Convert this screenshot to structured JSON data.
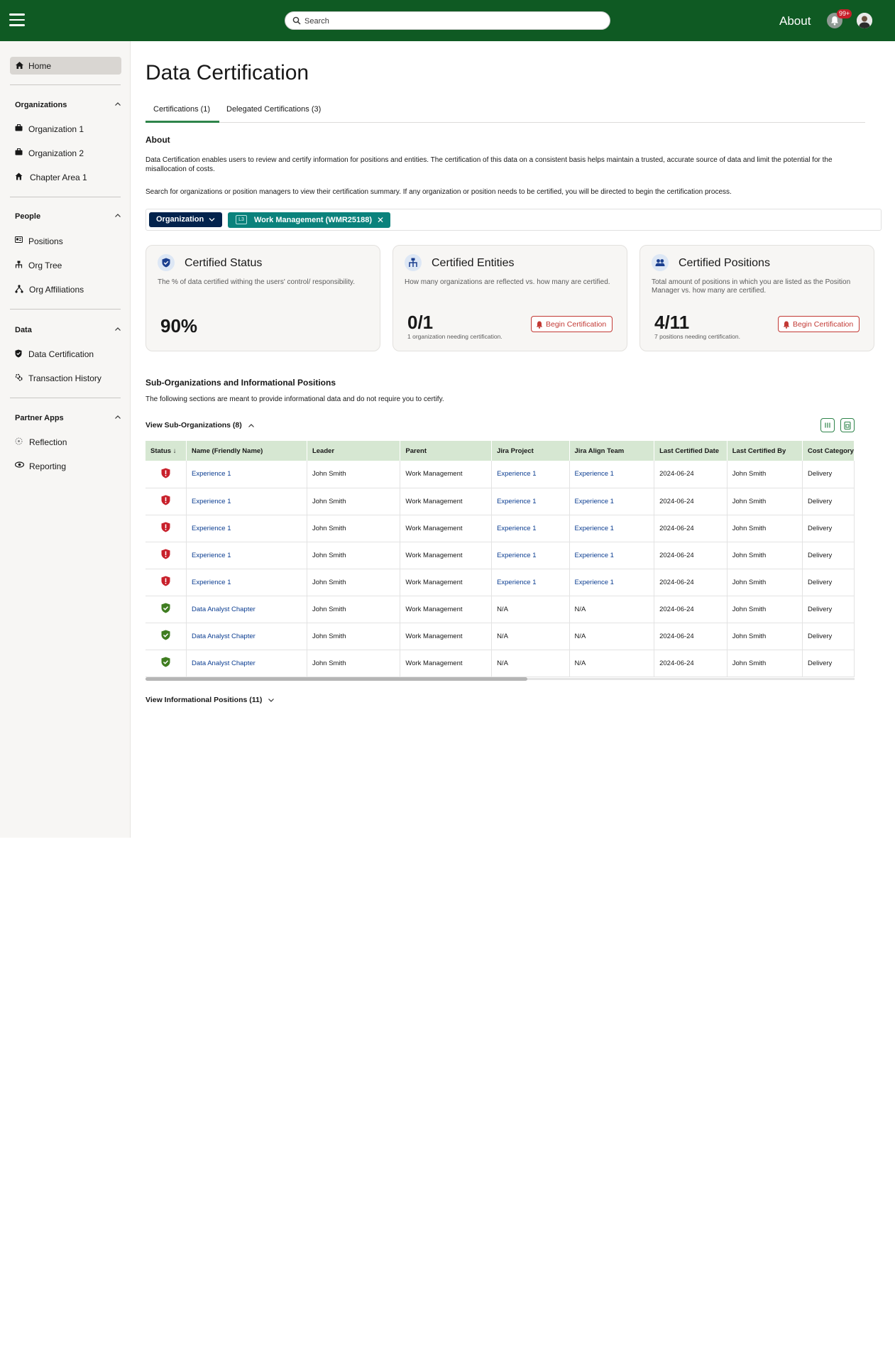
{
  "topbar": {
    "search_placeholder": "Search",
    "about": "About",
    "notification_badge": "99+",
    "bar_color": "#0f5a23"
  },
  "sidebar": {
    "home": "Home",
    "sections": [
      {
        "title": "Organizations",
        "items": [
          "Organization 1",
          "Organization 2",
          "Chapter Area 1"
        ]
      },
      {
        "title": "People",
        "items": [
          "Positions",
          "Org Tree",
          "Org Affiliations"
        ]
      },
      {
        "title": "Data",
        "items": [
          "Data Certification",
          "Transaction History"
        ]
      },
      {
        "title": "Partner Apps",
        "items": [
          "Reflection",
          "Reporting"
        ]
      }
    ]
  },
  "page": {
    "title": "Data Certification",
    "tabs": [
      "Certifications (1)",
      "Delegated Certifications (3)"
    ],
    "about_heading": "About",
    "about_text": "Data Certification enables users to review and certify information for positions and entities. The certification of this data on a consistent basis helps maintain a trusted, accurate source of data and limit the potential for the misallocation of costs.",
    "search_text": "Search for organizations or position managers to view their certification summary. If any organization or position needs to be certified, you will be directed to begin the certification process.",
    "filter": {
      "type_label": "Organization",
      "level": "L3",
      "selected": "Work Management (WMR25188)"
    }
  },
  "cards": [
    {
      "title": "Certified Status",
      "description": "The % of data certified withing the users' control/ responsibility.",
      "value": "90%",
      "note": "",
      "button": ""
    },
    {
      "title": "Certified Entities",
      "description": "How many organizations are reflected vs. how many are certified.",
      "value": "0/1",
      "note": "1 organization needing certification.",
      "button": "Begin Certification"
    },
    {
      "title": "Certified Positions",
      "description": "Total amount of positions in which you are listed as the Position Manager vs. how many are certified.",
      "value": "4/11",
      "note": "7 positions needing certification.",
      "button": "Begin Certification"
    }
  ],
  "sub_section": {
    "heading": "Sub-Organizations and Informational Positions",
    "description": "The following sections are meant to provide informational data and do not require you to certify.",
    "view_sub": "View Sub-Organizations (8)",
    "view_info": "View Informational Positions (11)"
  },
  "table": {
    "columns": [
      "Status",
      "Name (Friendly Name)",
      "Leader",
      "Parent",
      "Jira Project",
      "Jira Align Team",
      "Last Certified Date",
      "Last Certified By",
      "Cost Category"
    ],
    "rows": [
      {
        "status": "uncertified",
        "name": "Experience 1",
        "leader": "John Smith",
        "parent": "Work Management",
        "jira_project": "Experience 1",
        "jira_align": "Experience 1",
        "date": "2024-06-24",
        "by": "John Smith",
        "cost": "Delivery"
      },
      {
        "status": "uncertified",
        "name": "Experience 1",
        "leader": "John Smith",
        "parent": "Work Management",
        "jira_project": "Experience 1",
        "jira_align": "Experience 1",
        "date": "2024-06-24",
        "by": "John Smith",
        "cost": "Delivery"
      },
      {
        "status": "uncertified",
        "name": "Experience 1",
        "leader": "John Smith",
        "parent": "Work Management",
        "jira_project": "Experience 1",
        "jira_align": "Experience 1",
        "date": "2024-06-24",
        "by": "John Smith",
        "cost": "Delivery"
      },
      {
        "status": "uncertified",
        "name": "Experience 1",
        "leader": "John Smith",
        "parent": "Work Management",
        "jira_project": "Experience 1",
        "jira_align": "Experience 1",
        "date": "2024-06-24",
        "by": "John Smith",
        "cost": "Delivery"
      },
      {
        "status": "uncertified",
        "name": "Experience 1",
        "leader": "John Smith",
        "parent": "Work Management",
        "jira_project": "Experience 1",
        "jira_align": "Experience 1",
        "date": "2024-06-24",
        "by": "John Smith",
        "cost": "Delivery"
      },
      {
        "status": "certified",
        "name": "Data Analyst Chapter",
        "leader": "John Smith",
        "parent": "Work Management",
        "jira_project": "N/A",
        "jira_align": "N/A",
        "date": "2024-06-24",
        "by": "John Smith",
        "cost": "Delivery"
      },
      {
        "status": "certified",
        "name": "Data Analyst Chapter",
        "leader": "John Smith",
        "parent": "Work Management",
        "jira_project": "N/A",
        "jira_align": "N/A",
        "date": "2024-06-24",
        "by": "John Smith",
        "cost": "Delivery"
      },
      {
        "status": "certified",
        "name": "Data Analyst Chapter",
        "leader": "John Smith",
        "parent": "Work Management",
        "jira_project": "N/A",
        "jira_align": "N/A",
        "date": "2024-06-24",
        "by": "John Smith",
        "cost": "Delivery"
      }
    ],
    "colors": {
      "header_bg": "#d6e7d2",
      "uncertified": "#c8202b",
      "certified": "#3f7d20",
      "link": "#0b3d91"
    }
  }
}
